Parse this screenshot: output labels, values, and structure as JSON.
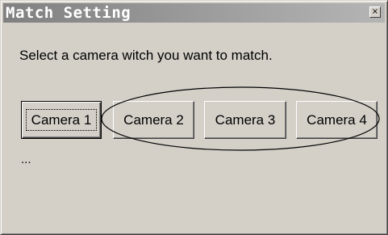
{
  "window": {
    "title": "Match Setting",
    "close_glyph": "×"
  },
  "content": {
    "instruction": "Select a camera witch you want to match.",
    "ellipsis": "..."
  },
  "buttons": [
    {
      "label": "Camera 1",
      "default": true
    },
    {
      "label": "Camera 2",
      "default": false
    },
    {
      "label": "Camera 3",
      "default": false
    },
    {
      "label": "Camera 4",
      "default": false
    }
  ],
  "colors": {
    "face": "#d4d0c8",
    "title_gradient_start": "#808080",
    "title_gradient_end": "#b5b5b5"
  }
}
